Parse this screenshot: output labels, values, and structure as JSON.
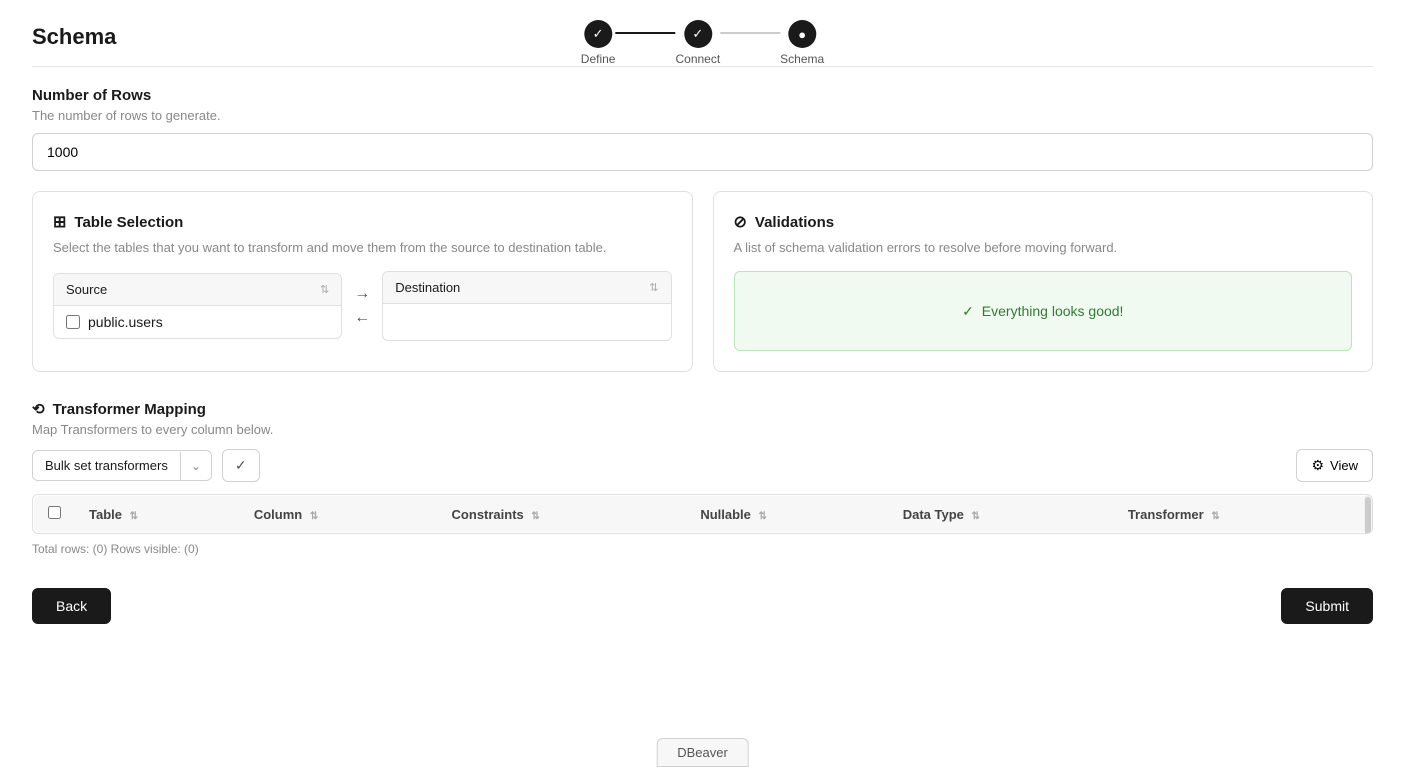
{
  "page": {
    "title": "Schema",
    "dbeaver_label": "DBeaver"
  },
  "stepper": {
    "steps": [
      {
        "label": "Define",
        "state": "done"
      },
      {
        "label": "Connect",
        "state": "done"
      },
      {
        "label": "Schema",
        "state": "active"
      }
    ],
    "lines": [
      "done",
      "partial"
    ]
  },
  "number_of_rows": {
    "label": "Number of Rows",
    "hint": "The number of rows to generate.",
    "value": "1000"
  },
  "table_selection": {
    "card_title": "Table Selection",
    "card_hint": "Select the tables that you want to transform and move them from the source to destination table.",
    "source": {
      "header": "Source",
      "rows": [
        {
          "label": "public.users",
          "checked": false
        }
      ]
    },
    "destination": {
      "header": "Destination",
      "rows": []
    }
  },
  "validations": {
    "card_title": "Validations",
    "card_hint": "A list of schema validation errors to resolve before moving forward.",
    "success_message": "Everything looks good!"
  },
  "transformer_mapping": {
    "section_title": "Transformer Mapping",
    "section_hint": "Map Transformers to every column below.",
    "bulk_label": "Bulk set transformers",
    "view_label": "View",
    "table_headers": [
      {
        "key": "table",
        "label": "Table",
        "sortable": true
      },
      {
        "key": "column",
        "label": "Column",
        "sortable": true
      },
      {
        "key": "constraints",
        "label": "Constraints",
        "sortable": true
      },
      {
        "key": "nullable",
        "label": "Nullable",
        "sortable": true
      },
      {
        "key": "data_type",
        "label": "Data Type",
        "sortable": true
      },
      {
        "key": "transformer",
        "label": "Transformer",
        "sortable": true
      }
    ],
    "rows": [],
    "total_rows_label": "Total rows: (0) Rows visible: (0)"
  },
  "footer": {
    "back_label": "Back",
    "submit_label": "Submit"
  }
}
